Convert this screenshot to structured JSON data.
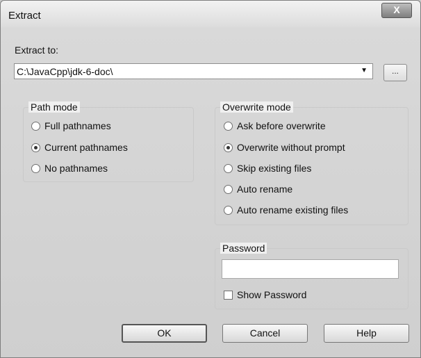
{
  "window": {
    "title": "Extract",
    "close_label": "X"
  },
  "extract_to": {
    "label": "Extract to:",
    "value": "C:\\JavaCpp\\jdk-6-doc\\",
    "dropdown_arrow": "▼",
    "browse_label": "..."
  },
  "path_mode": {
    "title": "Path mode",
    "options": [
      {
        "label": "Full pathnames",
        "checked": false
      },
      {
        "label": "Current pathnames",
        "checked": true
      },
      {
        "label": "No pathnames",
        "checked": false
      }
    ]
  },
  "overwrite_mode": {
    "title": "Overwrite mode",
    "options": [
      {
        "label": "Ask before overwrite",
        "checked": false
      },
      {
        "label": "Overwrite without prompt",
        "checked": true
      },
      {
        "label": "Skip existing files",
        "checked": false
      },
      {
        "label": "Auto rename",
        "checked": false
      },
      {
        "label": "Auto rename existing files",
        "checked": false
      }
    ]
  },
  "password": {
    "title": "Password",
    "value": "",
    "show_label": "Show Password",
    "show_checked": false
  },
  "buttons": {
    "ok": "OK",
    "cancel": "Cancel",
    "help": "Help"
  }
}
